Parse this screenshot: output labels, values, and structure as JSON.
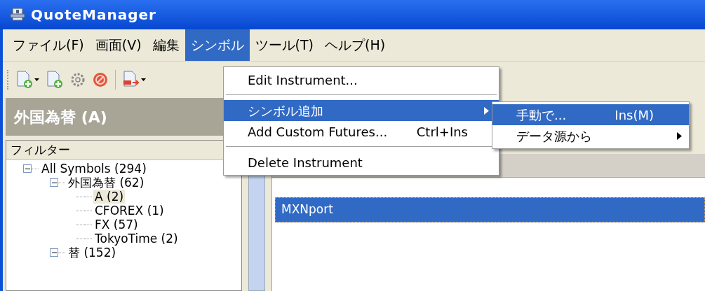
{
  "window": {
    "title": "QuoteManager"
  },
  "menu_bar": [
    {
      "label": "ファイル(F)",
      "selected": false
    },
    {
      "label": "画面(V)",
      "selected": false
    },
    {
      "label": "編集",
      "selected": false
    },
    {
      "label": "シンボル",
      "selected": true
    },
    {
      "label": "ツール(T)",
      "selected": false
    },
    {
      "label": "ヘルプ(H)",
      "selected": false
    }
  ],
  "panel": {
    "title": "外国為替 (A)",
    "filter": "フィルター"
  },
  "tree": [
    {
      "label": "All Symbols",
      "count": "(294)",
      "expanded": true,
      "selected": false,
      "children": [
        {
          "label": "外国為替",
          "count": "(62)",
          "expanded": true,
          "selected": false,
          "children": [
            {
              "label": "A",
              "count": "(2)",
              "selected": true
            },
            {
              "label": "CFOREX",
              "count": "(1)",
              "selected": false
            },
            {
              "label": "FX",
              "count": "(57)",
              "selected": false
            },
            {
              "label": "TokyoTime",
              "count": "(2)",
              "selected": false
            }
          ]
        },
        {
          "label": "替",
          "count": "(152)",
          "expanded": true,
          "selected": false
        }
      ]
    }
  ],
  "list": {
    "rows": [
      {
        "label": "MXNport",
        "selected": true
      }
    ]
  },
  "menu": {
    "items": [
      {
        "kind": "item",
        "label": "Edit Instrument...",
        "selected": false
      },
      {
        "kind": "separator"
      },
      {
        "kind": "submenu",
        "label": "シンボル追加",
        "selected": true
      },
      {
        "kind": "item",
        "label": "Add Custom Futures...",
        "shortcut": "Ctrl+Ins",
        "selected": false
      },
      {
        "kind": "separator"
      },
      {
        "kind": "item",
        "label": "Delete Instrument",
        "selected": false
      }
    ]
  },
  "submenu": {
    "items": [
      {
        "kind": "item",
        "label": "手動で...",
        "shortcut": "Ins(M)",
        "selected": true
      },
      {
        "kind": "submenu",
        "label": "データ源から",
        "selected": false
      }
    ]
  }
}
